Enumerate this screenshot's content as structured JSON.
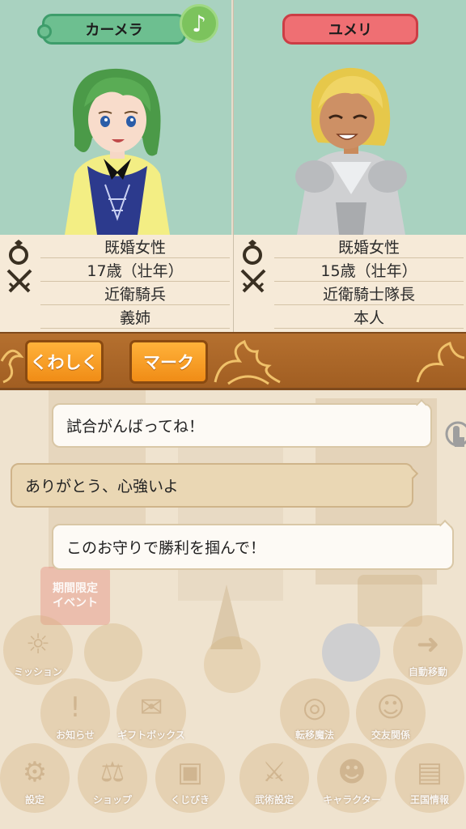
{
  "left_character": {
    "name": "カーメラ",
    "music_icon": "♪",
    "info": [
      "既婚女性",
      "17歳（壮年）",
      "近衛騎兵",
      "義姉"
    ]
  },
  "right_character": {
    "name": "ユメリ",
    "info": [
      "既婚女性",
      "15歳（壮年）",
      "近衛騎士隊長",
      "本人"
    ]
  },
  "actions": {
    "details_label": "くわしく",
    "mark_label": "マーク"
  },
  "chat": [
    {
      "text": "試合がんばってね！",
      "style": "white"
    },
    {
      "text": "ありがとう、心強いよ",
      "style": "tan"
    },
    {
      "text": "このお守りで勝利を掴んで！",
      "style": "white"
    }
  ],
  "background_menu": {
    "event_badge": [
      "期間限定",
      "イベント"
    ],
    "items": [
      "ミッション",
      "自動移動",
      "お知らせ",
      "ギフトボックス",
      "転移魔法",
      "交友関係",
      "設定",
      "ショップ",
      "くじびき",
      "武術設定",
      "キャラクター",
      "王国情報"
    ]
  },
  "colors": {
    "left_name_plate": "#6dbf90",
    "right_name_plate": "#ef6f73",
    "button_orange": "#f49a20",
    "action_bar": "#a86428",
    "panel_bg": "#a9d2c0"
  }
}
